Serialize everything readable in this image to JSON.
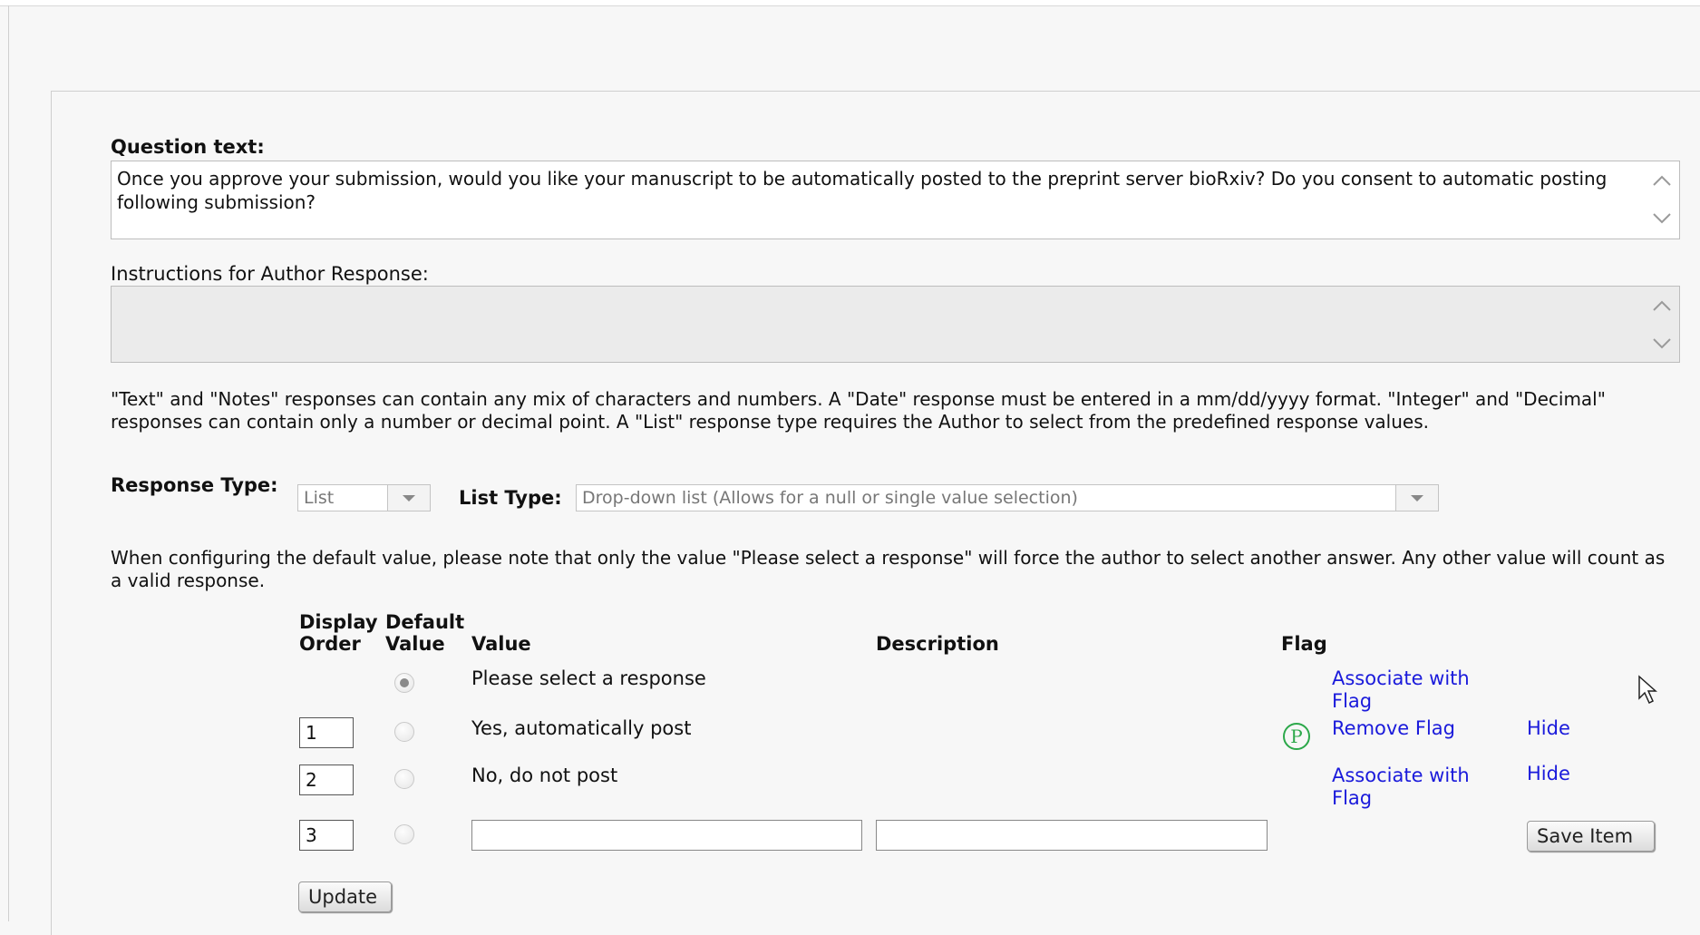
{
  "question": {
    "label": "Question text:",
    "text": "Once you approve your submission, would you like your manuscript to be automatically posted to the preprint server bioRxiv?  Do you consent to automatic posting following submission?"
  },
  "instructions": {
    "label": "Instructions for Author Response:",
    "text": ""
  },
  "help_text": "\"Text\" and \"Notes\" responses can contain any mix of characters and numbers. A \"Date\" response must be entered in a mm/dd/yyyy format. \"Integer\" and \"Decimal\" responses can contain only a number or decimal point. A \"List\" response type requires the Author to select from the predefined response values.",
  "response_type": {
    "label": "Response Type:",
    "value": "List"
  },
  "list_type": {
    "label": "List Type:",
    "value": "Drop-down list (Allows for a null or single value selection)"
  },
  "default_note": "When configuring the default value, please note that only the value \"Please select a response\" will force the author to select another answer. Any other value will count as a valid response.",
  "table": {
    "headers": {
      "display": "Display",
      "order": "Order",
      "default": "Default",
      "default_value": "Value",
      "value": "Value",
      "description": "Description",
      "flag": "Flag"
    },
    "rows": [
      {
        "order": "",
        "checked": true,
        "value": "Please select a response",
        "description": "",
        "flag_icon": "",
        "flag_action": "Associate with Flag",
        "hide": ""
      },
      {
        "order": "1",
        "checked": false,
        "value": "Yes, automatically post",
        "description": "",
        "flag_icon": "P",
        "flag_action": "Remove Flag",
        "hide": "Hide"
      },
      {
        "order": "2",
        "checked": false,
        "value": "No, do not post",
        "description": "",
        "flag_icon": "",
        "flag_action": "Associate with Flag",
        "hide": "Hide"
      },
      {
        "order": "3",
        "checked": false,
        "value": "",
        "description": "",
        "flag_icon": "",
        "flag_action": "",
        "hide": ""
      }
    ]
  },
  "buttons": {
    "save_item": "Save Item",
    "update": "Update"
  }
}
